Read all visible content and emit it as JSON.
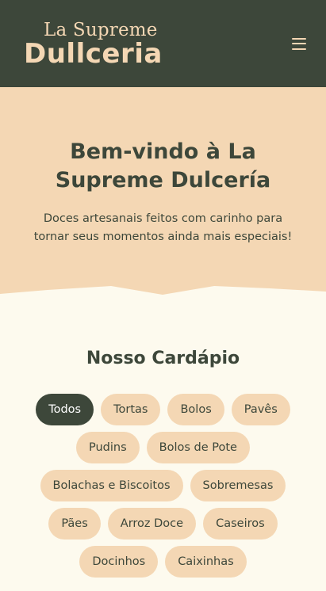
{
  "header": {
    "logo_top": "La Supreme",
    "logo_main": "Dullceria",
    "menu_icon": "hamburger-menu-icon"
  },
  "hero": {
    "title": "Bem-vindo à La Supreme Dulcería",
    "subtitle": "Doces artesanais feitos com carinho para tornar seus momentos ainda mais especiais!"
  },
  "menu": {
    "title": "Nosso Cardápio",
    "filters": [
      {
        "label": "Todos",
        "active": true
      },
      {
        "label": "Tortas",
        "active": false
      },
      {
        "label": "Bolos",
        "active": false
      },
      {
        "label": "Pavês",
        "active": false
      },
      {
        "label": "Pudins",
        "active": false
      },
      {
        "label": "Bolos de Pote",
        "active": false
      },
      {
        "label": "Bolachas e Biscoitos",
        "active": false
      },
      {
        "label": "Sobremesas",
        "active": false
      },
      {
        "label": "Pães",
        "active": false
      },
      {
        "label": "Arroz Doce",
        "active": false
      },
      {
        "label": "Caseiros",
        "active": false
      },
      {
        "label": "Docinhos",
        "active": false
      },
      {
        "label": "Caixinhas",
        "active": false
      }
    ]
  },
  "colors": {
    "primary_dark": "#3d473a",
    "accent_peach": "#f4d7b4",
    "background": "#fdfaee"
  }
}
